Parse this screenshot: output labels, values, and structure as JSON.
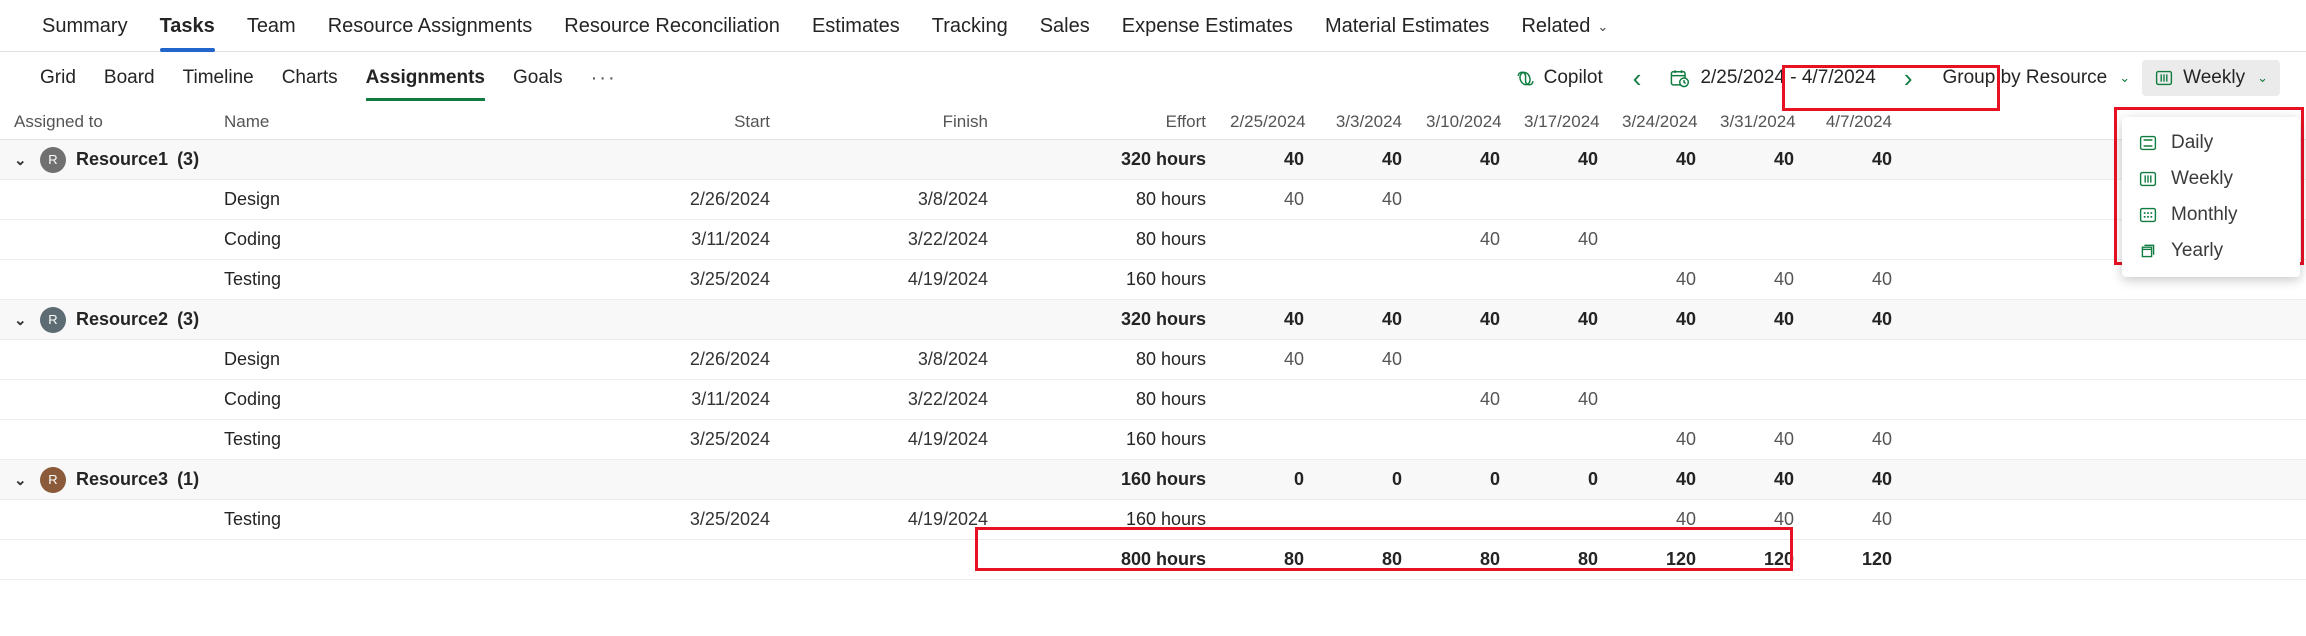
{
  "topnav": {
    "items": [
      {
        "label": "Summary",
        "active": false
      },
      {
        "label": "Tasks",
        "active": true
      },
      {
        "label": "Team",
        "active": false
      },
      {
        "label": "Resource Assignments",
        "active": false
      },
      {
        "label": "Resource Reconciliation",
        "active": false
      },
      {
        "label": "Estimates",
        "active": false
      },
      {
        "label": "Tracking",
        "active": false
      },
      {
        "label": "Sales",
        "active": false
      },
      {
        "label": "Expense Estimates",
        "active": false
      },
      {
        "label": "Material Estimates",
        "active": false
      },
      {
        "label": "Related",
        "active": false,
        "chevron": "⌄"
      }
    ]
  },
  "subtabs": {
    "items": [
      {
        "label": "Grid",
        "active": false
      },
      {
        "label": "Board",
        "active": false
      },
      {
        "label": "Timeline",
        "active": false
      },
      {
        "label": "Charts",
        "active": false
      },
      {
        "label": "Assignments",
        "active": true
      },
      {
        "label": "Goals",
        "active": false
      }
    ],
    "overflow_label": "···"
  },
  "toolbar": {
    "copilot_label": "Copilot",
    "prev_arrow": "‹",
    "next_arrow": "›",
    "date_range": "2/25/2024 - 4/7/2024",
    "group_by_label": "Group by Resource",
    "scale_label": "Weekly",
    "chevron": "⌄"
  },
  "scale_menu": {
    "items": [
      {
        "label": "Daily",
        "icon": "daily-view-icon"
      },
      {
        "label": "Weekly",
        "icon": "weekly-view-icon"
      },
      {
        "label": "Monthly",
        "icon": "monthly-view-icon"
      },
      {
        "label": "Yearly",
        "icon": "yearly-view-icon"
      }
    ]
  },
  "table": {
    "columns": {
      "assigned_to": "Assigned to",
      "name": "Name",
      "start": "Start",
      "finish": "Finish",
      "effort": "Effort"
    },
    "date_columns": [
      "2/25/2024",
      "3/3/2024",
      "3/10/2024",
      "3/17/2024",
      "3/24/2024",
      "3/31/2024",
      "4/7/2024"
    ],
    "groups": [
      {
        "name": "Resource1",
        "count": "(3)",
        "avatar_initial": "R",
        "avatar_color": "#707070",
        "chevron": "⌄",
        "effort": "320 hours",
        "values": [
          "40",
          "40",
          "40",
          "40",
          "40",
          "40",
          "40"
        ],
        "tasks": [
          {
            "name": "Design",
            "start": "2/26/2024",
            "finish": "3/8/2024",
            "effort": "80 hours",
            "values": [
              "40",
              "40",
              "",
              "",
              "",
              "",
              ""
            ]
          },
          {
            "name": "Coding",
            "start": "3/11/2024",
            "finish": "3/22/2024",
            "effort": "80 hours",
            "values": [
              "",
              "",
              "40",
              "40",
              "",
              "",
              ""
            ]
          },
          {
            "name": "Testing",
            "start": "3/25/2024",
            "finish": "4/19/2024",
            "effort": "160 hours",
            "values": [
              "",
              "",
              "",
              "",
              "40",
              "40",
              "40"
            ]
          }
        ]
      },
      {
        "name": "Resource2",
        "count": "(3)",
        "avatar_initial": "R",
        "avatar_color": "#5d6b73",
        "chevron": "⌄",
        "effort": "320 hours",
        "values": [
          "40",
          "40",
          "40",
          "40",
          "40",
          "40",
          "40"
        ],
        "tasks": [
          {
            "name": "Design",
            "start": "2/26/2024",
            "finish": "3/8/2024",
            "effort": "80 hours",
            "values": [
              "40",
              "40",
              "",
              "",
              "",
              "",
              ""
            ]
          },
          {
            "name": "Coding",
            "start": "3/11/2024",
            "finish": "3/22/2024",
            "effort": "80 hours",
            "values": [
              "",
              "",
              "40",
              "40",
              "",
              "",
              ""
            ]
          },
          {
            "name": "Testing",
            "start": "3/25/2024",
            "finish": "4/19/2024",
            "effort": "160 hours",
            "values": [
              "",
              "",
              "",
              "",
              "40",
              "40",
              "40"
            ]
          }
        ]
      },
      {
        "name": "Resource3",
        "count": "(1)",
        "avatar_initial": "R",
        "avatar_color": "#8a5a3b",
        "chevron": "⌄",
        "effort": "160 hours",
        "values": [
          "0",
          "0",
          "0",
          "0",
          "40",
          "40",
          "40"
        ],
        "tasks": [
          {
            "name": "Testing",
            "start": "3/25/2024",
            "finish": "4/19/2024",
            "effort": "160 hours",
            "values": [
              "",
              "",
              "",
              "",
              "40",
              "40",
              "40"
            ]
          }
        ]
      }
    ],
    "total_row": {
      "effort": "800 hours",
      "values": [
        "80",
        "80",
        "80",
        "80",
        "120",
        "120",
        "120"
      ]
    }
  },
  "colors": {
    "accent_green": "#107c41",
    "accent_blue": "#2266cc",
    "annotation_red": "#e81123"
  }
}
